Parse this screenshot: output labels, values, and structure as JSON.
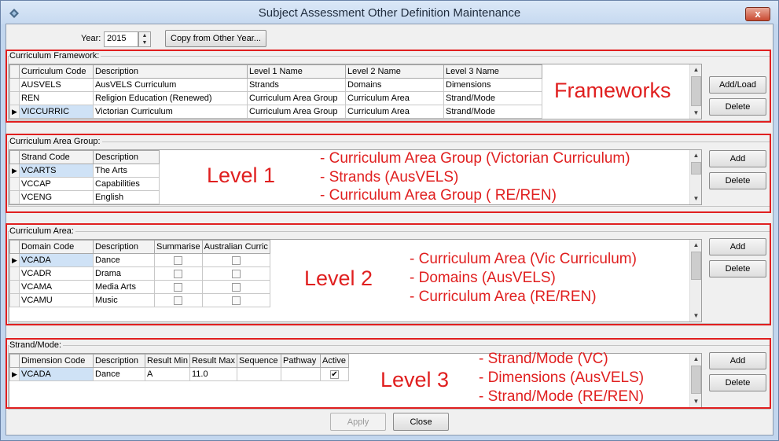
{
  "window": {
    "title": "Subject Assessment Other Definition Maintenance",
    "close_glyph": "x"
  },
  "toolbar": {
    "year_label": "Year:",
    "year_value": "2015",
    "copy_button": "Copy from Other Year..."
  },
  "frameworks": {
    "group_label": "Curriculum Framework:",
    "columns": [
      "Curriculum Code",
      "Description",
      "Level 1 Name",
      "Level 2 Name",
      "Level 3 Name"
    ],
    "rows": [
      [
        "AUSVELS",
        "AusVELS Curriculum",
        "Strands",
        "Domains",
        "Dimensions"
      ],
      [
        "REN",
        "Religion Education (Renewed)",
        "Curriculum Area Group",
        "Curriculum Area",
        "Strand/Mode"
      ],
      [
        "VICCURRIC",
        "Victorian Curriculum",
        "Curriculum Area Group",
        "Curriculum Area",
        "Strand/Mode"
      ]
    ],
    "add_button": "Add/Load",
    "delete_button": "Delete"
  },
  "area_group": {
    "group_label": "Curriculum Area Group:",
    "columns": [
      "Strand Code",
      "Description"
    ],
    "rows": [
      [
        "VCARTS",
        "The Arts"
      ],
      [
        "VCCAP",
        "Capabilities"
      ],
      [
        "VCENG",
        "English"
      ]
    ],
    "add_button": "Add",
    "delete_button": "Delete"
  },
  "area": {
    "group_label": "Curriculum Area:",
    "columns": [
      "Domain Code",
      "Description",
      "Summarise",
      "Australian Curric"
    ],
    "rows": [
      [
        "VCADA",
        "Dance"
      ],
      [
        "VCADR",
        "Drama"
      ],
      [
        "VCAMA",
        "Media Arts"
      ],
      [
        "VCAMU",
        "Music"
      ]
    ],
    "add_button": "Add",
    "delete_button": "Delete"
  },
  "strand": {
    "group_label": "Strand/Mode:",
    "columns": [
      "Dimension Code",
      "Description",
      "Result Min",
      "Result Max",
      "Sequence",
      "Pathway",
      "Active"
    ],
    "rows": [
      [
        "VCADA",
        "Dance",
        "A",
        "11.0",
        "",
        ""
      ]
    ],
    "add_button": "Add",
    "delete_button": "Delete"
  },
  "footer": {
    "apply_button": "Apply",
    "close_button": "Close"
  },
  "annotations": {
    "frameworks": "Frameworks",
    "level1": "Level 1",
    "level1_lines": [
      "- Curriculum Area Group (Victorian Curriculum)",
      "- Strands (AusVELS)",
      "- Curriculum Area Group ( RE/REN)"
    ],
    "level2": "Level 2",
    "level2_lines": [
      "- Curriculum Area (Vic Curriculum)",
      "- Domains (AusVELS)",
      "- Curriculum Area (RE/REN)"
    ],
    "level3": "Level 3",
    "level3_lines": [
      "- Strand/Mode (VC)",
      "- Dimensions (AusVELS)",
      "- Strand/Mode (RE/REN)"
    ],
    "color": "#e01f1f"
  }
}
